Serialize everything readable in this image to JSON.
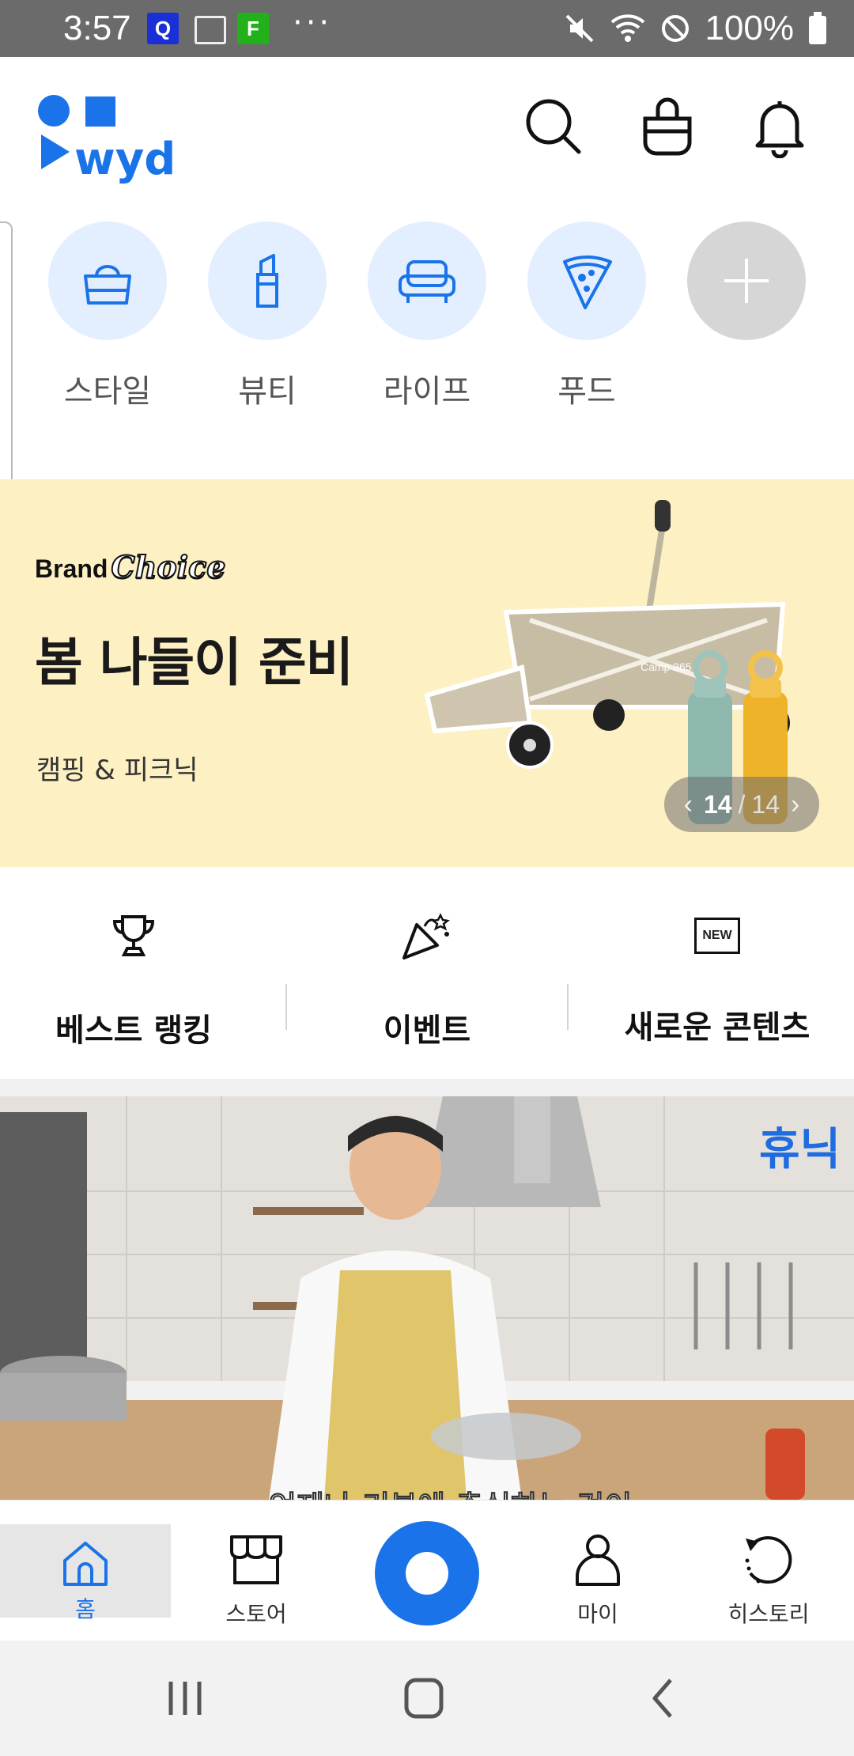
{
  "status_bar": {
    "time": "3:57",
    "app_icons": [
      "Q",
      "card-icon",
      "F"
    ],
    "more": "···",
    "battery": "100%",
    "icons": [
      "mute-icon",
      "wifi-icon",
      "block-icon",
      "battery-icon"
    ]
  },
  "header": {
    "logo_text": "wyd",
    "icons": [
      "search-icon",
      "shopping-bag-icon",
      "bell-icon"
    ]
  },
  "categories": [
    {
      "label": "스타일",
      "icon": "handbag-icon"
    },
    {
      "label": "뷰티",
      "icon": "lipstick-icon"
    },
    {
      "label": "라이프",
      "icon": "sofa-icon"
    },
    {
      "label": "푸드",
      "icon": "pizza-icon"
    },
    {
      "label": "",
      "icon": "plus-icon"
    }
  ],
  "banner": {
    "brand_prefix": "Brand",
    "brand_script": "Choice",
    "title": "봄 나들이 준비",
    "subtitle": "캠핑 & 피크닉",
    "page_current": "14",
    "page_separator": "/",
    "page_total": "14",
    "product_mark": "Camp 365",
    "background": "#fdf0c3"
  },
  "quick_menu": [
    {
      "label": "베스트 랭킹",
      "icon": "trophy-icon"
    },
    {
      "label": "이벤트",
      "icon": "party-popper-icon"
    },
    {
      "label": "새로운 콘텐츠",
      "icon": "new-badge-icon",
      "icon_text": "NEW"
    }
  ],
  "video": {
    "badge": "휴닉",
    "caption": "언제나 기본에 충실하는 것이"
  },
  "bottom_nav": [
    {
      "label": "홈",
      "icon": "home-icon",
      "active": true
    },
    {
      "label": "스토어",
      "icon": "store-icon",
      "active": false
    },
    {
      "label": "",
      "icon": "record-button-icon",
      "active": false
    },
    {
      "label": "마이",
      "icon": "person-icon",
      "active": false
    },
    {
      "label": "히스토리",
      "icon": "history-icon",
      "active": false
    }
  ],
  "colors": {
    "accent": "#1a73e8",
    "category_bg": "#e3efff",
    "status_bar": "#6b6b6b"
  }
}
